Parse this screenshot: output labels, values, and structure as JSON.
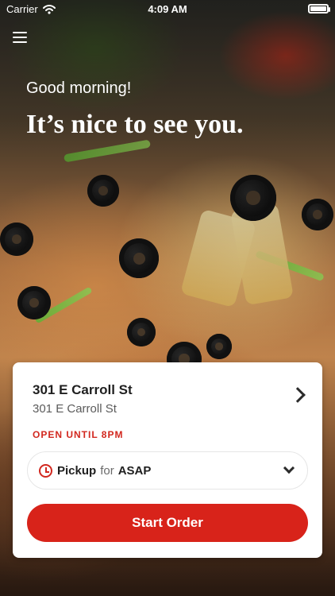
{
  "status_bar": {
    "carrier": "Carrier",
    "time": "4:09 AM"
  },
  "greeting": "Good morning!",
  "headline": "It’s nice to see you.",
  "store": {
    "name": "301 E Carroll St",
    "address": "301 E Carroll St",
    "hours": "OPEN UNTIL 8PM"
  },
  "order": {
    "method": "Pickup",
    "connector": "for",
    "time": "ASAP",
    "start_label": "Start Order"
  },
  "icons": {
    "menu": "menu-icon",
    "chevron": "chevron-right-icon",
    "caret": "chevron-down-icon",
    "clock": "clock-icon",
    "wifi": "wifi-icon",
    "battery": "battery-icon"
  },
  "colors": {
    "accent": "#d8231a",
    "hours": "#d2281f"
  }
}
